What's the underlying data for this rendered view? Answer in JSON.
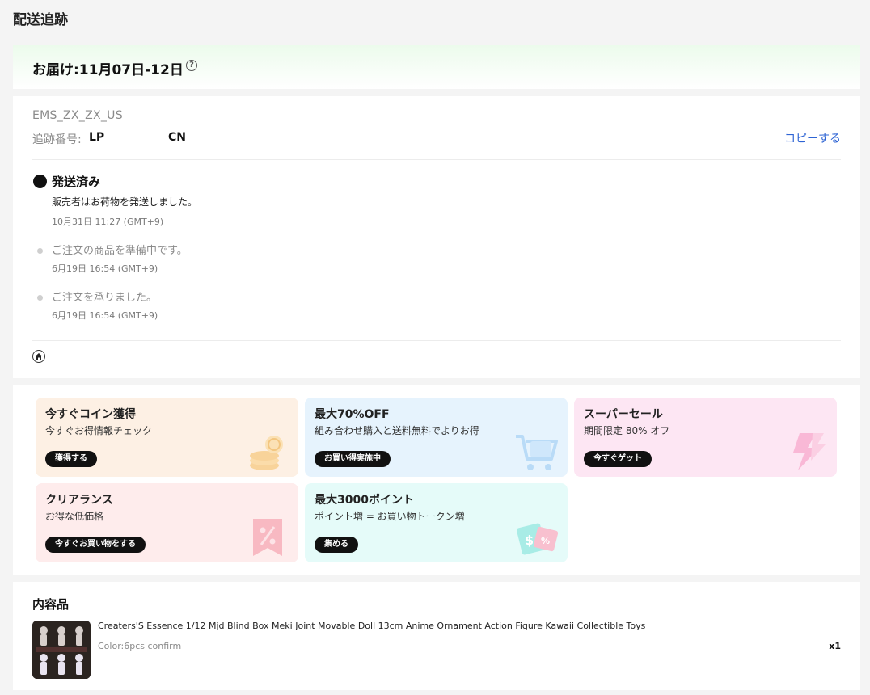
{
  "page": {
    "title": "配送追跡"
  },
  "delivery": {
    "estimate": "お届け:11月07日-12日",
    "help_glyph": "?"
  },
  "tracking": {
    "carrier": "EMS_ZX_ZX_US",
    "number_label": "追跡番号:",
    "number_prefix": "LP",
    "number_suffix": "CN",
    "copy_label": "コピーする"
  },
  "timeline": {
    "status": "発送済み",
    "events": [
      {
        "desc": "販売者はお荷物を発送しました。",
        "time": "10月31日 11:27 (GMT+9)"
      },
      {
        "desc": "ご注文の商品を準備中です。",
        "time": "6月19日 16:54 (GMT+9)"
      },
      {
        "desc": "ご注文を承りました。",
        "time": "6月19日 16:54 (GMT+9)"
      }
    ]
  },
  "promos": [
    {
      "title": "今すぐコイン獲得",
      "subtitle": "今すぐお得情報チェック",
      "button": "獲得する",
      "bg": "#fdf0e4",
      "icon": "coins-icon"
    },
    {
      "title": "最大70%OFF",
      "subtitle": "組み合わせ購入と送料無料でよりお得",
      "button": "お買い得実施中",
      "bg": "#e6f3fd",
      "icon": "cart-icon"
    },
    {
      "title": "スーパーセール",
      "subtitle": "期間限定 80% オフ",
      "button": "今すぐゲット",
      "bg": "#fde6f3",
      "icon": "lightning-icon"
    },
    {
      "title": "クリアランス",
      "subtitle": "お得な低価格",
      "button": "今すぐお買い物をする",
      "bg": "#feecec",
      "icon": "percent-tag-icon"
    },
    {
      "title": "最大3000ポイント",
      "subtitle": "ポイント増 = お買い物トークン増",
      "button": "集める",
      "bg": "#e5fbf9",
      "icon": "coupon-icon"
    }
  ],
  "contents": {
    "title": "内容品",
    "item": {
      "name": "Creaters'S Essence 1/12 Mjd Blind Box Meki Joint Movable Doll 13cm Anime Ornament Action Figure Kawaii Collectible Toys",
      "variant": "Color:6pcs confirm",
      "qty": "x1"
    }
  }
}
